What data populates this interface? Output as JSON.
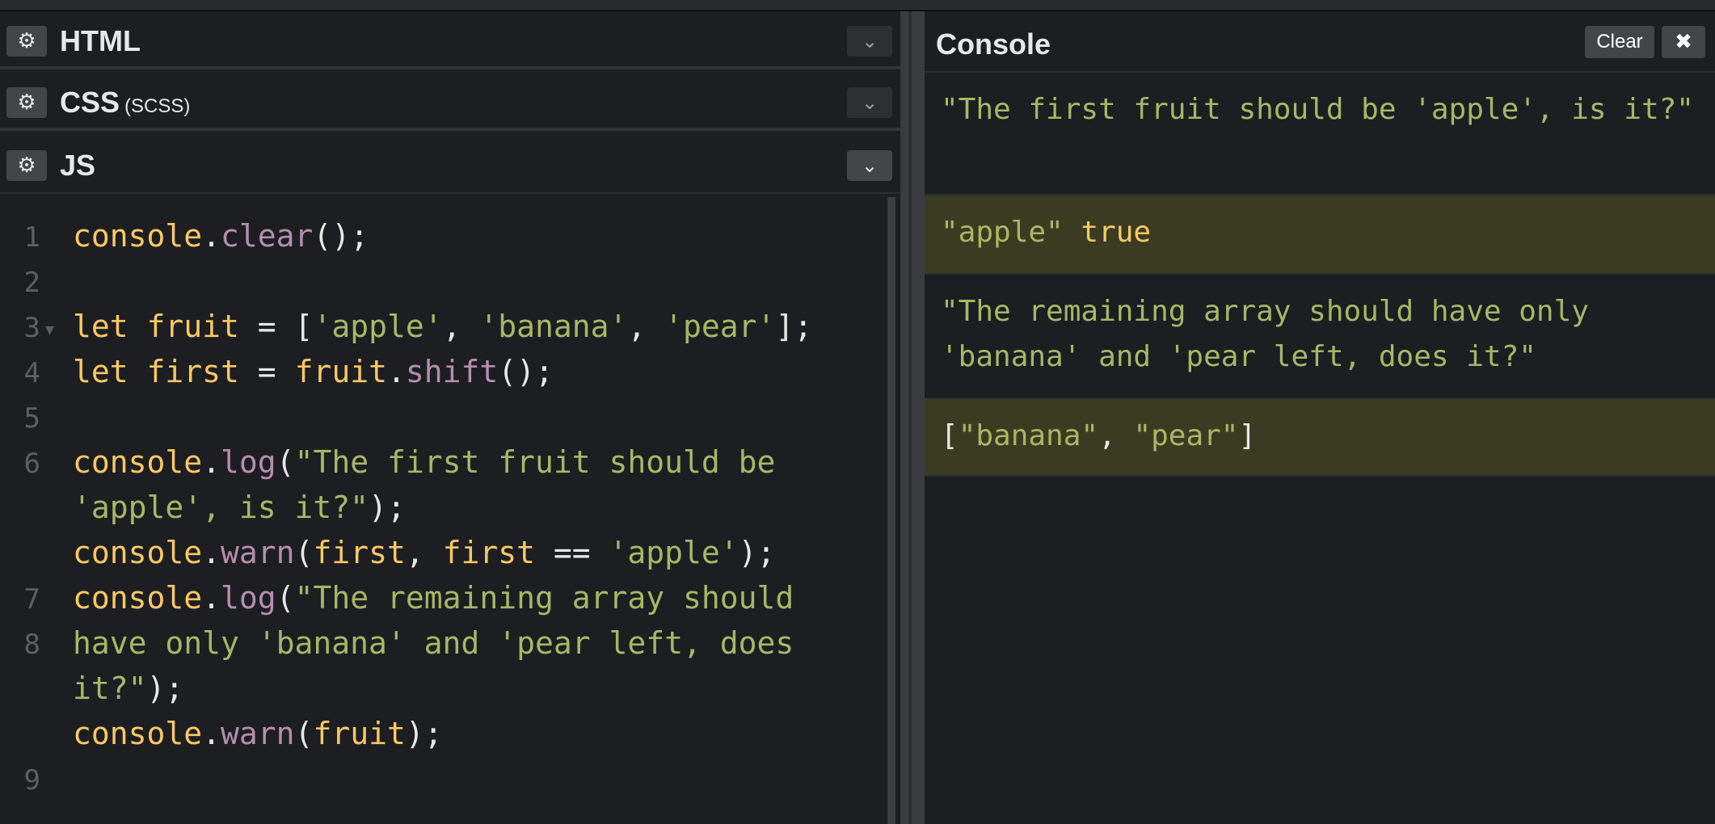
{
  "panels": {
    "html": {
      "title": "HTML",
      "gear": "⚙",
      "chevron": "⌄"
    },
    "css": {
      "title": "CSS",
      "subtitle": "(SCSS)",
      "gear": "⚙",
      "chevron": "⌄"
    },
    "js": {
      "title": "JS",
      "gear": "⚙",
      "chevron": "⌄"
    }
  },
  "editor": {
    "line_numbers": [
      "1",
      "2",
      "3",
      "4",
      "5",
      "6",
      "7",
      "8",
      "9"
    ],
    "lines": {
      "l1": {
        "obj": "console",
        "dot": ".",
        "fn": "clear",
        "rest": "();"
      },
      "l3": {
        "kw": "let",
        "name": "fruit",
        "eq": " = [",
        "s1": "'apple'",
        "c1": ", ",
        "s2": "'banana'",
        "c2": ", ",
        "s3": "'pear'",
        "end": "];"
      },
      "l4": {
        "kw": "let",
        "name": "first",
        "eq": " = ",
        "obj": "fruit",
        "dot": ".",
        "fn": "shift",
        "rest": "();"
      },
      "l6a": {
        "obj": "console",
        "dot": ".",
        "fn": "log",
        "open": "(",
        "str": "\"The first fruit should be"
      },
      "l6b": {
        "str": "'apple', is it?\"",
        "end": ");"
      },
      "l7": {
        "obj": "console",
        "dot": ".",
        "fn": "warn",
        "open": "(",
        "a1": "first",
        "c1": ", ",
        "a2": "first",
        "eq": " == ",
        "s": "'apple'",
        "end": ");"
      },
      "l8a": {
        "obj": "console",
        "dot": ".",
        "fn": "log",
        "open": "(",
        "str": "\"The remaining array should"
      },
      "l8b": {
        "str": "have only 'banana' and 'pear left, does"
      },
      "l8c": {
        "str": "it?\"",
        "end": ");"
      },
      "l9": {
        "obj": "console",
        "dot": ".",
        "fn": "warn",
        "open": "(",
        "arg": "fruit",
        "end": ");"
      }
    }
  },
  "console": {
    "title": "Console",
    "clear_label": "Clear",
    "close_label": "✖",
    "entries": {
      "e1": {
        "text": "\"The first fruit should be 'apple', is it?\""
      },
      "e2": {
        "str": "\"apple\"",
        "bool": "true"
      },
      "e3": {
        "text": "\"The remaining array should have only 'banana' and 'pear left, does it?\""
      },
      "e4": {
        "open": "[",
        "s1": "\"banana\"",
        "sep": ", ",
        "s2": "\"pear\"",
        "close": "]"
      }
    }
  },
  "colors": {
    "background": "#1d1e22",
    "string": "#a9b665",
    "variable": "#fac863",
    "function": "#b48ead",
    "warn_background": "#3a3c22"
  }
}
